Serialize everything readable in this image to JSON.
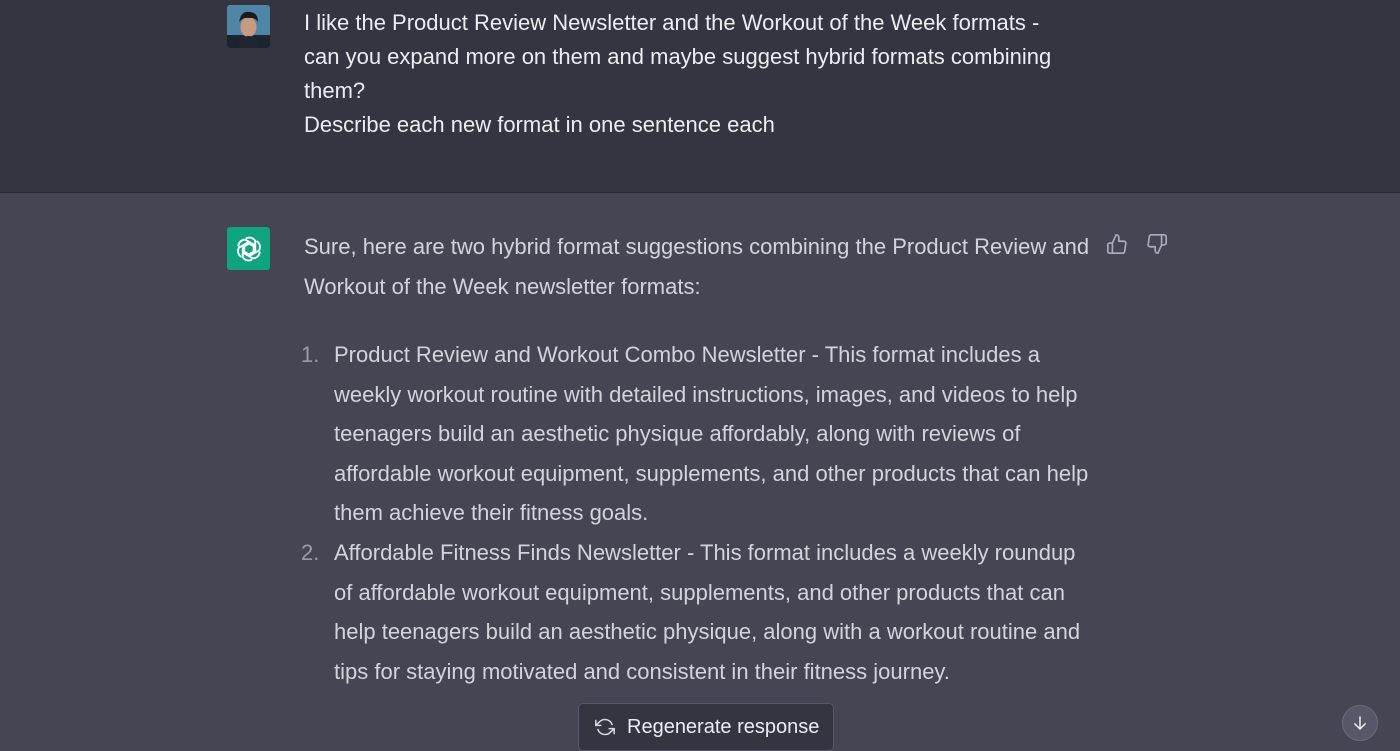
{
  "user_message": {
    "lines": [
      "I like the Product Review Newsletter and the Workout of the Week formats -",
      "can you expand more on them and maybe suggest hybrid formats combining",
      "them?",
      "Describe each new format in one sentence each"
    ],
    "avatar_icon": "user-photo-avatar"
  },
  "assistant_message": {
    "avatar_icon": "openai-logo-icon",
    "avatar_color": "#10a37f",
    "intro": "Sure, here are two hybrid format suggestions combining the Product Review and Workout of the Week newsletter formats:",
    "items": [
      {
        "number": "1.",
        "text": "Product Review and Workout Combo Newsletter - This format includes a weekly workout routine with detailed instructions, images, and videos to help teenagers build an aesthetic physique affordably, along with reviews of affordable workout equipment, supplements, and other products that can help them achieve their fitness goals."
      },
      {
        "number": "2.",
        "text": "Affordable Fitness Finds Newsletter - This format includes a weekly roundup of affordable workout equipment, supplements, and other products that can help teenagers build an aesthetic physique, along with a workout routine and tips for staying motivated and consistent in their fitness journey."
      }
    ]
  },
  "controls": {
    "regenerate_label": "Regenerate response",
    "thumbs_up_icon": "thumbs-up-icon",
    "thumbs_down_icon": "thumbs-down-icon",
    "scroll_down_icon": "arrow-down-icon"
  },
  "colors": {
    "user_bg": "#343541",
    "assistant_bg": "#444654",
    "accent": "#10a37f"
  }
}
